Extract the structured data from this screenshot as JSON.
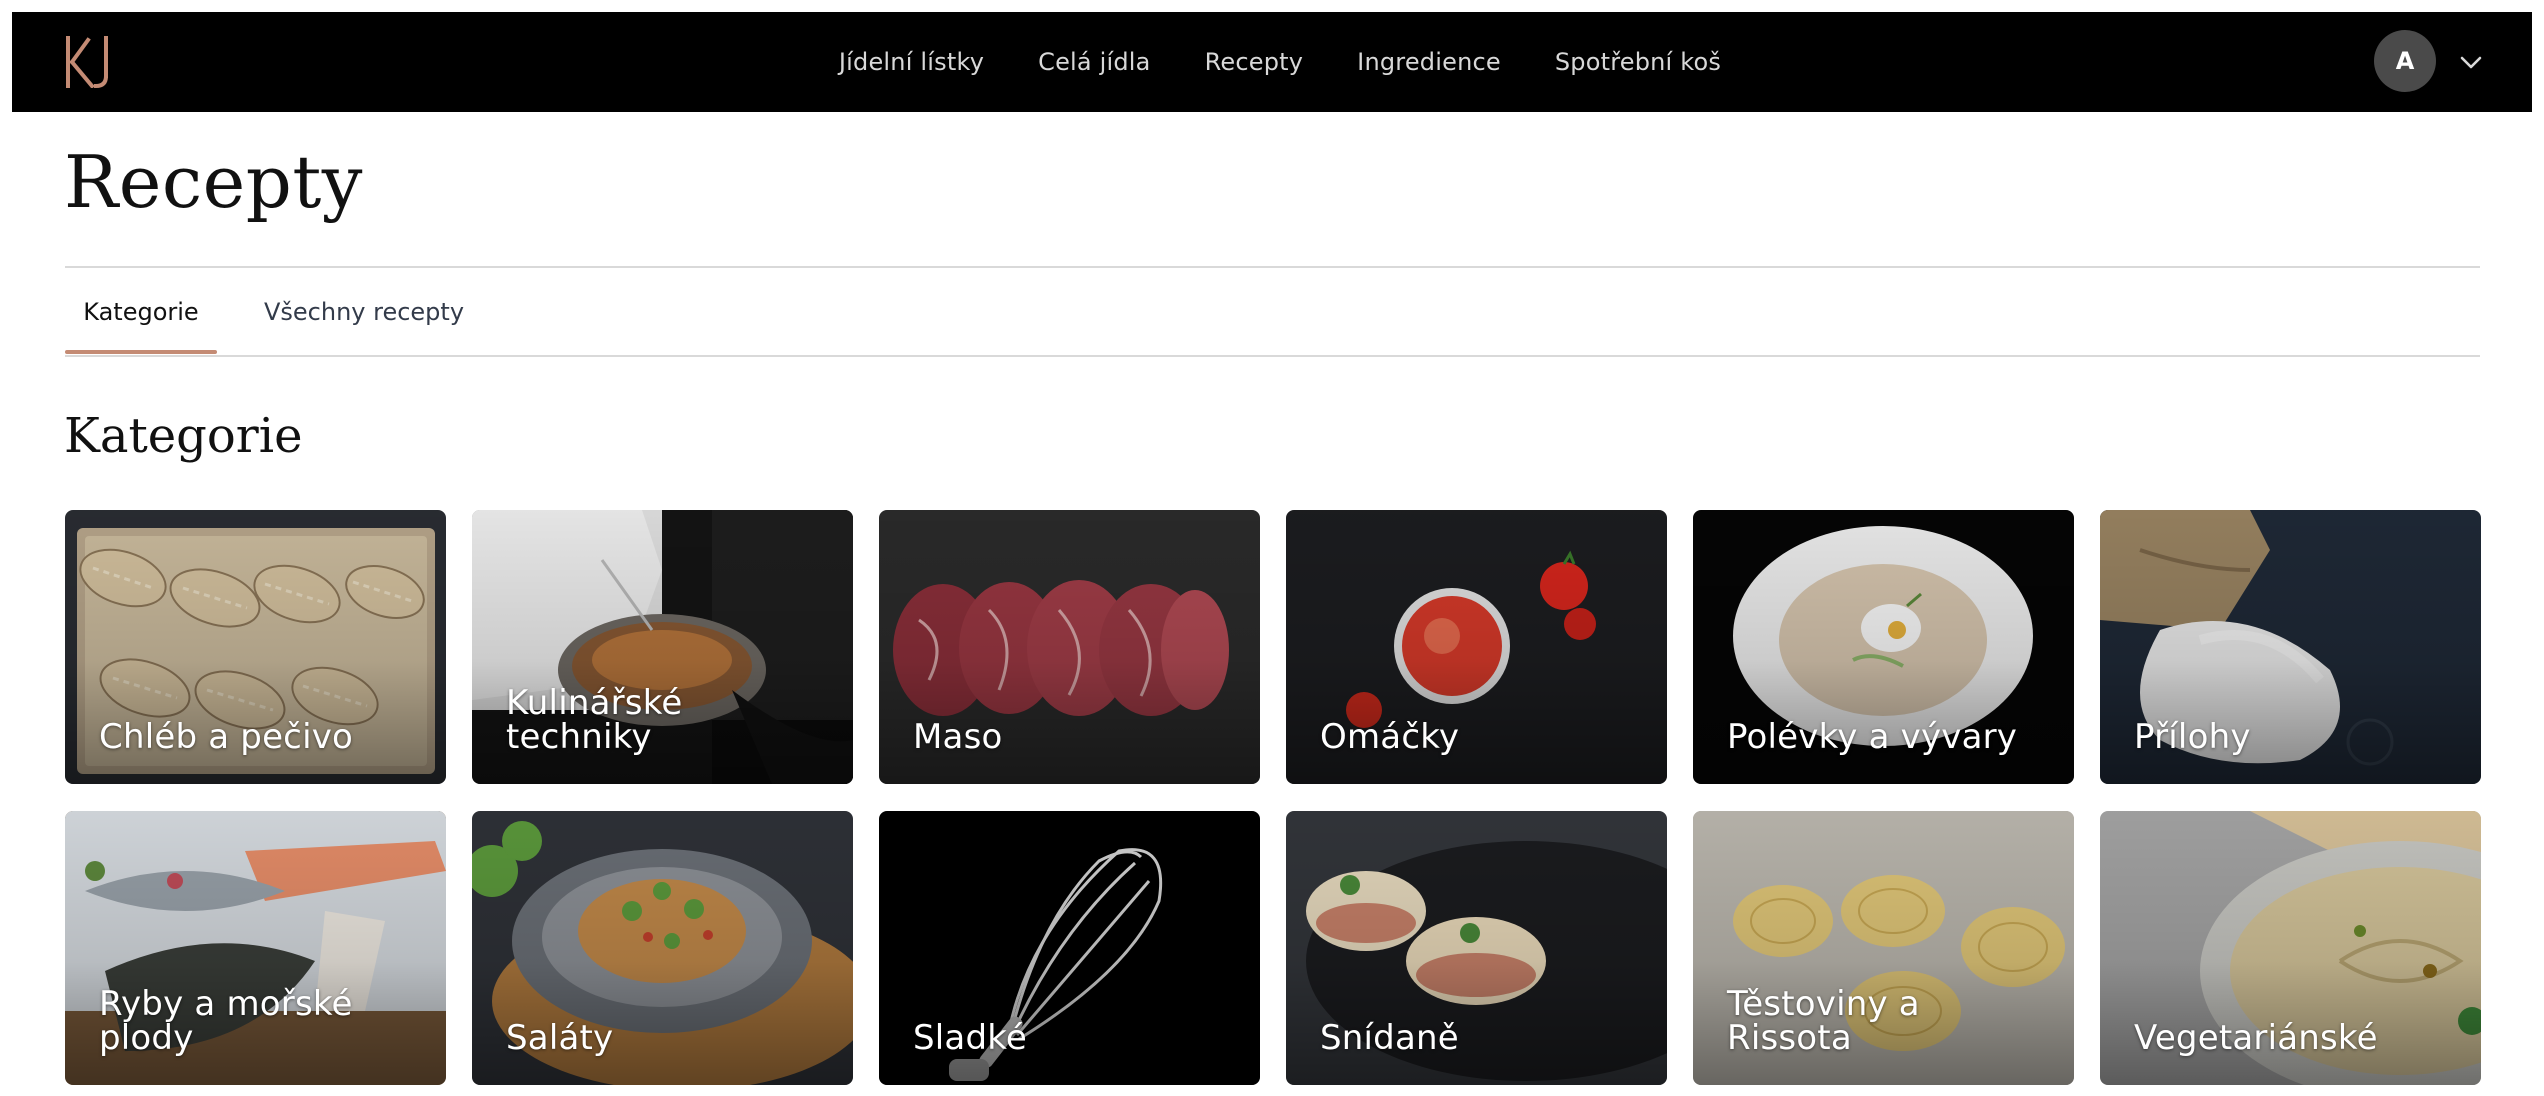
{
  "header": {
    "logo_text": "KJ",
    "nav": [
      {
        "label": "Jídelní lístky"
      },
      {
        "label": "Celá jídla"
      },
      {
        "label": "Recepty"
      },
      {
        "label": "Ingredience"
      },
      {
        "label": "Spotřební koš"
      }
    ],
    "avatar_initial": "A"
  },
  "page": {
    "title": "Recepty",
    "tabs": [
      {
        "label": "Kategorie",
        "active": true
      },
      {
        "label": "Všechny recepty",
        "active": false
      }
    ],
    "section_title": "Kategorie"
  },
  "categories": [
    {
      "label": "Chléb a pečivo",
      "image": "bread-loaves"
    },
    {
      "label": "Kulinářské techniky",
      "image": "chef-pan"
    },
    {
      "label": "Maso",
      "image": "raw-steaks"
    },
    {
      "label": "Omáčky",
      "image": "tomato-sauce"
    },
    {
      "label": "Polévky a vývary",
      "image": "soup-plate"
    },
    {
      "label": "Přílohy",
      "image": "rice-sack"
    },
    {
      "label": "Ryby a mořské plody",
      "image": "fish-on-ice"
    },
    {
      "label": "Saláty",
      "image": "salad-plate"
    },
    {
      "label": "Sladké",
      "image": "whisk"
    },
    {
      "label": "Snídaně",
      "image": "eggs-benedict"
    },
    {
      "label": "Těstoviny a Rissota",
      "image": "pasta-nests"
    },
    {
      "label": "Vegetariánské",
      "image": "hummus-bowl"
    }
  ],
  "colors": {
    "topbar": "#000000",
    "accent_underline": "#c48b74",
    "logo": "#c48b74"
  }
}
